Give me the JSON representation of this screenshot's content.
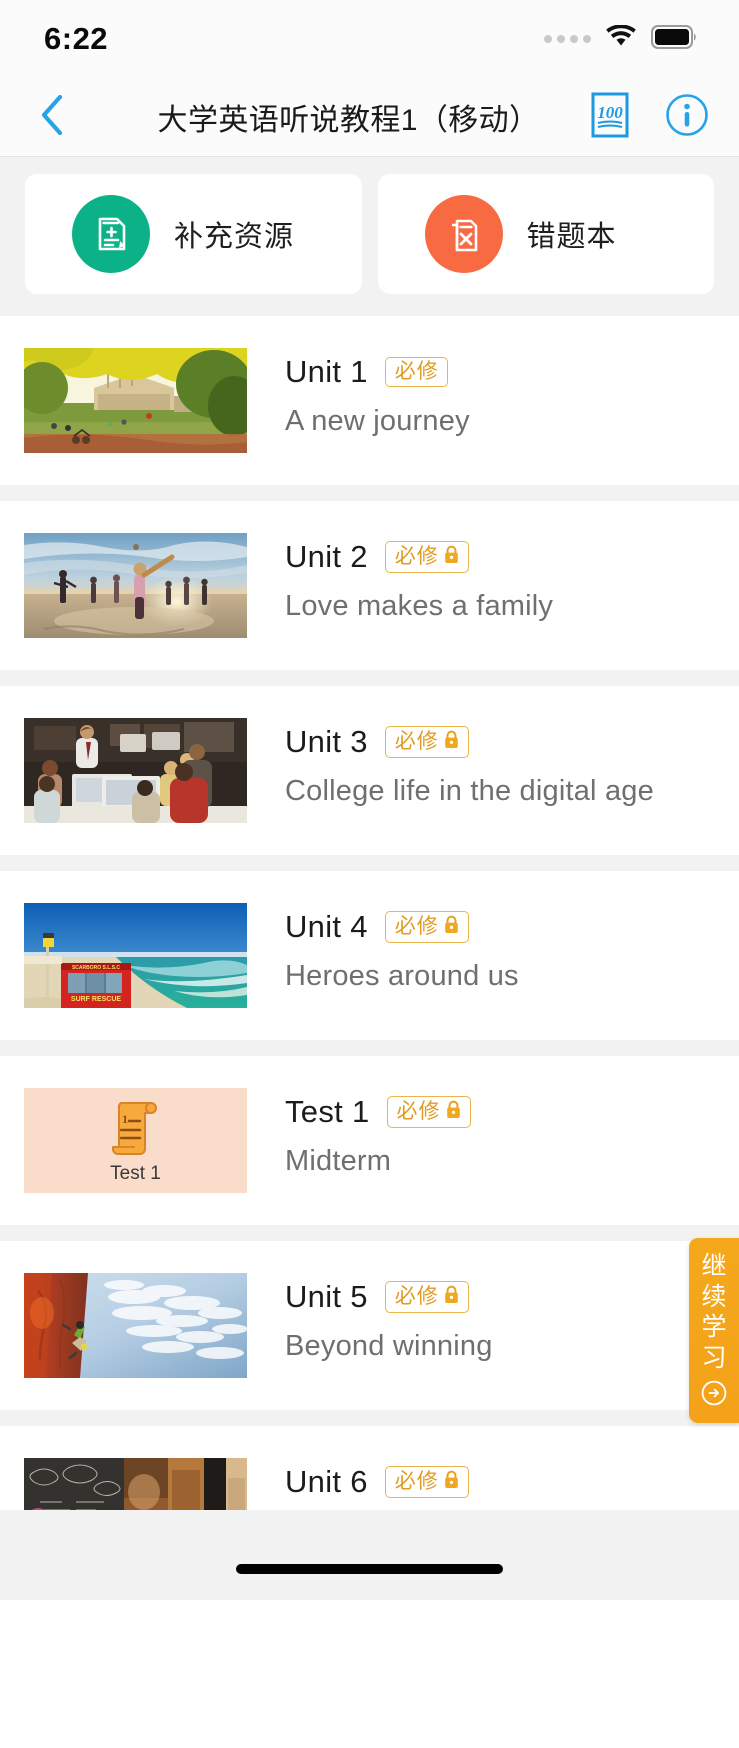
{
  "status_bar": {
    "time": "6:22",
    "signal_icon": "signal-dots-icon",
    "wifi_icon": "wifi-icon",
    "battery_icon": "battery-full-icon"
  },
  "nav": {
    "back_icon": "chevron-left-icon",
    "title": "大学英语听说教程1（移动）",
    "score_icon": "hundred-score-icon",
    "score_icon_text": "100",
    "info_icon": "info-circle-icon",
    "back_color": "#2196f3",
    "accent_color": "#2196f3"
  },
  "quick_actions": [
    {
      "label": "补充资源",
      "icon": "document-plus-icon",
      "circle_color": "#0cb287"
    },
    {
      "label": "错题本",
      "icon": "document-cross-icon",
      "circle_color": "#f86a42"
    }
  ],
  "badge": {
    "text": "必修",
    "lock_icon": "lock-icon",
    "border_color": "#e9b44c",
    "text_color": "#e09b20"
  },
  "units": [
    {
      "title": "Unit 1",
      "subtitle": "A new journey",
      "locked": false,
      "thumb": "autumn-park-campus-photo"
    },
    {
      "title": "Unit 2",
      "subtitle": "Love makes a family",
      "locked": true,
      "thumb": "beach-sunset-family-photo"
    },
    {
      "title": "Unit 3",
      "subtitle": "College life in the digital age",
      "locked": true,
      "thumb": "students-computer-lab-photo"
    },
    {
      "title": "Unit 4",
      "subtitle": "Heroes around us",
      "locked": true,
      "thumb": "surf-rescue-hut-beach-photo"
    },
    {
      "title": "Test 1",
      "subtitle": "Midterm",
      "locked": true,
      "thumb": "test-scroll-icon",
      "thumb_label": "Test 1",
      "is_test": true
    },
    {
      "title": "Unit 5",
      "subtitle": "Beyond winning",
      "locked": true,
      "thumb": "rock-climbing-cliff-photo"
    },
    {
      "title": "Unit 6",
      "subtitle": "",
      "locked": true,
      "thumb": "chalkboard-cafe-photo"
    }
  ],
  "fab": {
    "chars": [
      "继",
      "续",
      "学",
      "习"
    ],
    "arrow_icon": "arrow-right-circle-icon",
    "color": "#f4a51b"
  }
}
